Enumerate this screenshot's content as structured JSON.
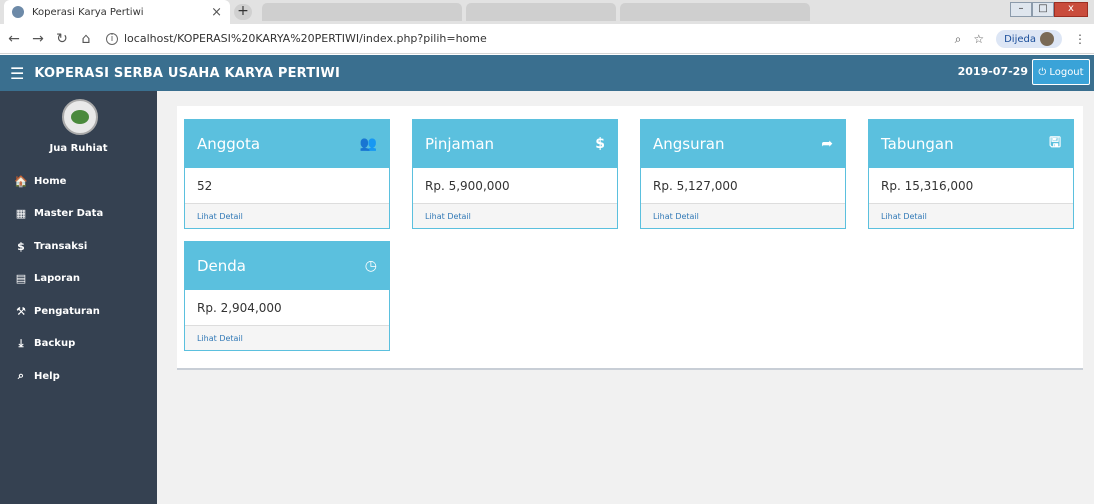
{
  "browser": {
    "tab_title": "Koperasi Karya Pertiwi",
    "tab_close": "×",
    "new_tab": "+",
    "url": "localhost/KOPERASI%20KARYA%20PERTIWI/index.php?pilih=home",
    "profile_name": "Dijeda",
    "win_min": "–",
    "win_max": "□",
    "win_close": "x"
  },
  "header": {
    "title": "KOPERASI SERBA USAHA KARYA PERTIWI",
    "date": "2019-07-29",
    "logout_label": "Logout",
    "color": "#3a6f8f"
  },
  "sidebar": {
    "user_name": "Jua Ruhiat",
    "items": [
      {
        "icon": "home-icon",
        "glyph": "🏠",
        "label": "Home"
      },
      {
        "icon": "grid-icon",
        "glyph": "▦",
        "label": "Master Data"
      },
      {
        "icon": "dollar-icon",
        "glyph": "$",
        "label": "Transaksi"
      },
      {
        "icon": "report-icon",
        "glyph": "▤",
        "label": "Laporan"
      },
      {
        "icon": "wrench-icon",
        "glyph": "⚒",
        "label": "Pengaturan"
      },
      {
        "icon": "download-icon",
        "glyph": "⤓",
        "label": "Backup"
      },
      {
        "icon": "help-icon",
        "glyph": "⌕",
        "label": "Help"
      }
    ]
  },
  "cards": [
    {
      "title": "Anggota",
      "icon": "users-icon",
      "glyph": "👥",
      "value": "52",
      "link": "Lihat Detail"
    },
    {
      "title": "Pinjaman",
      "icon": "dollar-icon",
      "glyph": "$",
      "value": "Rp. 5,900,000",
      "link": "Lihat Detail"
    },
    {
      "title": "Angsuran",
      "icon": "share-icon",
      "glyph": "➦",
      "value": "Rp. 5,127,000",
      "link": "Lihat Detail"
    },
    {
      "title": "Tabungan",
      "icon": "save-icon",
      "glyph": "🖫",
      "value": "Rp. 15,316,000",
      "link": "Lihat Detail"
    },
    {
      "title": "Denda",
      "icon": "clock-icon",
      "glyph": "◷",
      "value": "Rp. 2,904,000",
      "link": "Lihat Detail"
    }
  ],
  "colors": {
    "card_accent": "#5bc0de",
    "sidebar": "#354151",
    "logout_button": "#3aa3d8"
  }
}
